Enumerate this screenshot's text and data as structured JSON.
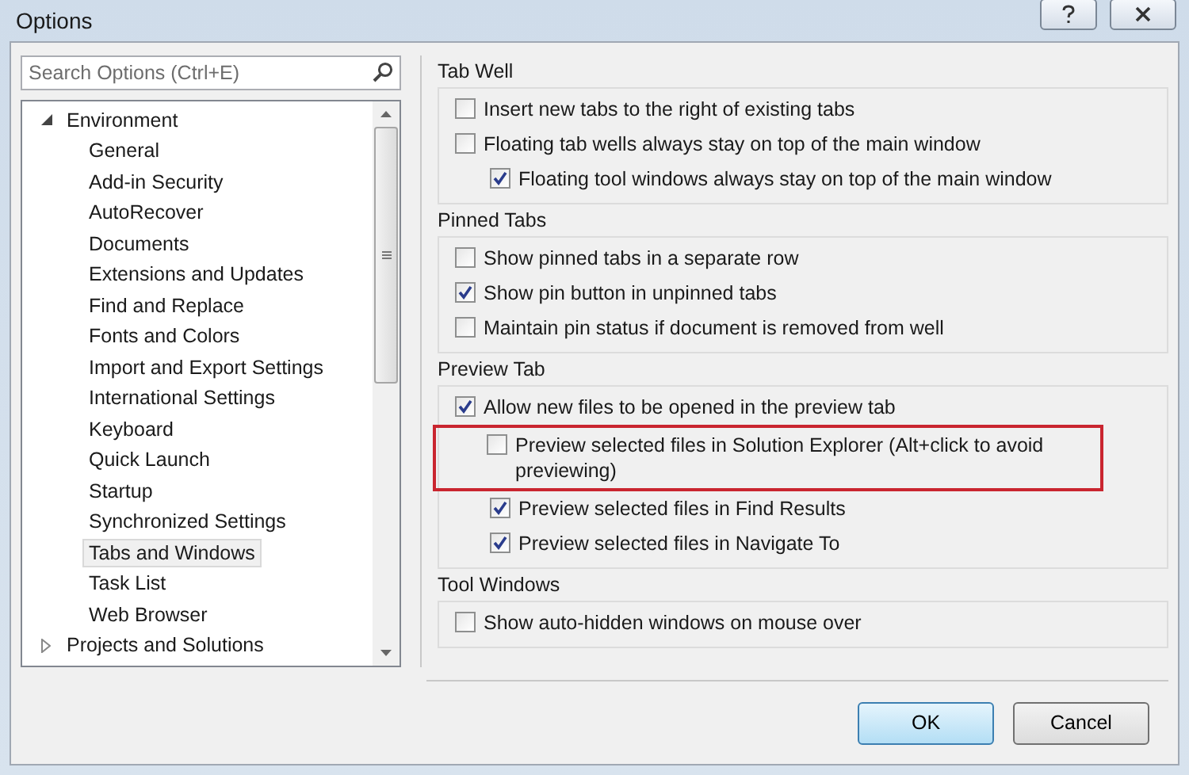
{
  "window": {
    "title": "Options"
  },
  "search": {
    "placeholder": "Search Options (Ctrl+E)"
  },
  "tree": [
    {
      "label": "Environment",
      "expanded": true,
      "selected": false,
      "children": [
        {
          "label": "General",
          "selected": false
        },
        {
          "label": "Add-in Security",
          "selected": false
        },
        {
          "label": "AutoRecover",
          "selected": false
        },
        {
          "label": "Documents",
          "selected": false
        },
        {
          "label": "Extensions and Updates",
          "selected": false
        },
        {
          "label": "Find and Replace",
          "selected": false
        },
        {
          "label": "Fonts and Colors",
          "selected": false
        },
        {
          "label": "Import and Export Settings",
          "selected": false
        },
        {
          "label": "International Settings",
          "selected": false
        },
        {
          "label": "Keyboard",
          "selected": false
        },
        {
          "label": "Quick Launch",
          "selected": false
        },
        {
          "label": "Startup",
          "selected": false
        },
        {
          "label": "Synchronized Settings",
          "selected": false
        },
        {
          "label": "Tabs and Windows",
          "selected": true
        },
        {
          "label": "Task List",
          "selected": false
        },
        {
          "label": "Web Browser",
          "selected": false
        }
      ]
    },
    {
      "label": "Projects and Solutions",
      "expanded": false,
      "selected": false
    }
  ],
  "groups": [
    {
      "title": "Tab Well",
      "options": [
        {
          "label": "Insert new tabs to the right of existing tabs",
          "checked": false
        },
        {
          "label": "Floating tab wells always stay on top of the main window",
          "checked": false,
          "children": [
            {
              "label": "Floating tool windows always stay on top of the main window",
              "checked": true
            }
          ]
        }
      ]
    },
    {
      "title": "Pinned Tabs",
      "options": [
        {
          "label": "Show pinned tabs in a separate row",
          "checked": false
        },
        {
          "label": "Show pin button in unpinned tabs",
          "checked": true
        },
        {
          "label": "Maintain pin status if document is removed from well",
          "checked": false
        }
      ]
    },
    {
      "title": "Preview Tab",
      "options": [
        {
          "label": "Allow new files to be opened in the preview tab",
          "checked": true,
          "children": [
            {
              "label": "Preview selected files in Solution Explorer (Alt+click to avoid previewing)",
              "checked": false,
              "highlighted": true
            },
            {
              "label": "Preview selected files in Find Results",
              "checked": true
            },
            {
              "label": "Preview selected files in Navigate To",
              "checked": true
            }
          ]
        }
      ]
    },
    {
      "title": "Tool Windows",
      "options": [
        {
          "label": "Show auto-hidden windows on mouse over",
          "checked": false
        }
      ]
    }
  ],
  "buttons": [
    {
      "label": "OK",
      "kind": "default"
    },
    {
      "label": "Cancel",
      "kind": "normal"
    }
  ]
}
